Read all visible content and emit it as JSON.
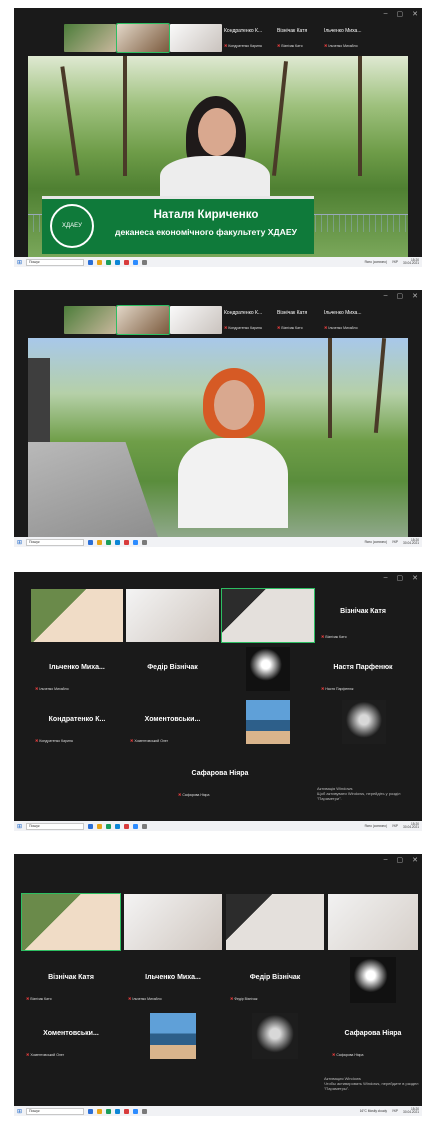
{
  "taskbar": {
    "search_placeholder": "Пошук",
    "weather_1": "Ясно (сонячно)",
    "weather_2": "Ясно (сонячно)",
    "weather_3": "Ясно (сонячно)",
    "weather_4": "16°C Mostly cloudy",
    "lang": "УКР",
    "time": "15:20",
    "date": "30.04.2021"
  },
  "screen1": {
    "strip_names": [
      {
        "title": "Кондратенко К...",
        "sub": "Кондратенко Карина"
      },
      {
        "title": "Візнічак Катя",
        "sub": "Візнічак Катя"
      },
      {
        "title": "Ільченко Миха...",
        "sub": "Ільченко Михайло"
      }
    ],
    "banner_name": "Наталя Кириченко",
    "banner_title": "деканеса економічного факультету ХДАЕУ",
    "logo_text": "ХДАЕУ"
  },
  "screen2": {
    "strip_names": [
      {
        "title": "Кондратенко К...",
        "sub": "Кондратенко Карина"
      },
      {
        "title": "Візнічак Катя",
        "sub": "Візнічак Катя"
      },
      {
        "title": "Ільченко Миха...",
        "sub": "Ільченко Михайло"
      }
    ]
  },
  "screen3": {
    "tiles": [
      {
        "name": "Візнічак Катя",
        "sub": "Візнічак Катя"
      },
      {
        "name": "Ільченко Миха...",
        "sub": "Ільченко Михайло"
      },
      {
        "name": "Федір Візнічак",
        "sub": "Федір Візнічак"
      },
      {
        "name": "Настя Парфенюк",
        "sub": "Настя Парфенюк"
      },
      {
        "name": "Кондратенко К...",
        "sub": "Кондратенко Карина"
      },
      {
        "name": "Хоментовськи...",
        "sub": "Хоментовський Олег"
      },
      {
        "name": "Сафарова Ніяра",
        "sub": "Сафарова Ніяра"
      }
    ],
    "activate_title": "Активація Windows",
    "activate_sub": "Щоб активувати Windows, перейдіть у розділ \"Параметри\"."
  },
  "screen4": {
    "tiles": [
      {
        "name": "Візнічак Катя",
        "sub": "Візнічак Катя"
      },
      {
        "name": "Ільченко Миха...",
        "sub": "Ільченко Михайло"
      },
      {
        "name": "Федір Візнічак",
        "sub": "Федір Візнічак"
      },
      {
        "name": "Хоментовськи...",
        "sub": "Хоментовський Олег"
      },
      {
        "name": "Сафарова Ніяра",
        "sub": "Сафарова Ніяра"
      }
    ],
    "activate_title": "Активация Windows",
    "activate_sub": "Чтобы активировать Windows, перейдите в раздел \"Параметры\"."
  }
}
